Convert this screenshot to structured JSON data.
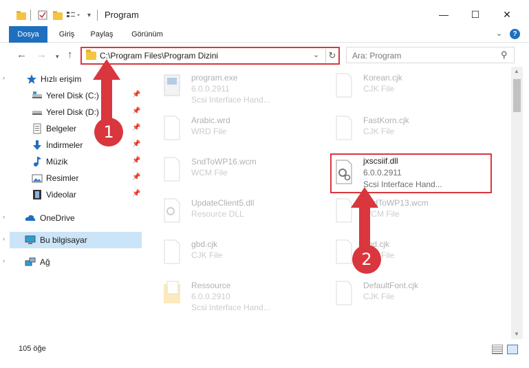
{
  "window": {
    "title": "Program"
  },
  "ribbon": {
    "tabs": [
      "Dosya",
      "Giriş",
      "Paylaş",
      "Görünüm"
    ]
  },
  "address": {
    "path": "C:\\Program Files\\Program Dizini"
  },
  "search": {
    "placeholder": "Ara: Program"
  },
  "sidebar": {
    "items": [
      {
        "label": "Hızlı erişim",
        "icon": "star-icon"
      },
      {
        "label": "Yerel Disk (C:)",
        "icon": "drive-icon",
        "pinned": true
      },
      {
        "label": "Yerel Disk (D:)",
        "icon": "drive-icon",
        "pinned": true
      },
      {
        "label": "Belgeler",
        "icon": "documents-icon",
        "pinned": true
      },
      {
        "label": "İndirmeler",
        "icon": "download-icon",
        "pinned": true
      },
      {
        "label": "Müzik",
        "icon": "music-icon",
        "pinned": true
      },
      {
        "label": "Resimler",
        "icon": "pictures-icon",
        "pinned": true
      },
      {
        "label": "Videolar",
        "icon": "video-icon",
        "pinned": true
      },
      {
        "label": "OneDrive",
        "icon": "cloud-icon"
      },
      {
        "label": "Bu bilgisayar",
        "icon": "computer-icon",
        "selected": true
      },
      {
        "label": "Ağ",
        "icon": "network-icon"
      }
    ]
  },
  "files": [
    {
      "name": "program.exe",
      "sub1": "6.0.0.2911",
      "sub2": "Scsi Interface Hand...",
      "icon": "exe-icon"
    },
    {
      "name": "Korean.cjk",
      "sub1": "CJK File",
      "sub2": "",
      "icon": "file-icon"
    },
    {
      "name": "Arabic.wrd",
      "sub1": "WRD File",
      "sub2": "",
      "icon": "file-icon"
    },
    {
      "name": "FastKorn.cjk",
      "sub1": "CJK File",
      "sub2": "",
      "icon": "file-icon"
    },
    {
      "name": "SndToWP16.wcm",
      "sub1": "WCM File",
      "sub2": "",
      "icon": "file-icon"
    },
    {
      "name": "jxscsiif.dll",
      "sub1": "6.0.0.2911",
      "sub2": "Scsi Interface Hand...",
      "icon": "dll-icon"
    },
    {
      "name": "UpdateClient5.dll",
      "sub1": "Resource DLL",
      "sub2": "",
      "icon": "dll-icon"
    },
    {
      "name": "SndToWP13.wcm",
      "sub1": "WCM File",
      "sub2": "",
      "icon": "file-icon"
    },
    {
      "name": "gbd.cjk",
      "sub1": "CJK File",
      "sub2": "",
      "icon": "file-icon"
    },
    {
      "name": "gbd.cjk",
      "sub1": "CJK File",
      "sub2": "",
      "icon": "file-icon"
    },
    {
      "name": "Ressource",
      "sub1": "6.0.0.2910",
      "sub2": "Scsi Interface Hand...",
      "icon": "folder-doc-icon"
    },
    {
      "name": "DefaultFont.cjk",
      "sub1": "CJK File",
      "sub2": "",
      "icon": "file-icon"
    }
  ],
  "callouts": [
    "1",
    "2"
  ],
  "status": {
    "count": "105 öğe"
  },
  "colors": {
    "accent": "#1f6fbf",
    "highlight": "#d9363e",
    "selected": "#cce4f7"
  }
}
